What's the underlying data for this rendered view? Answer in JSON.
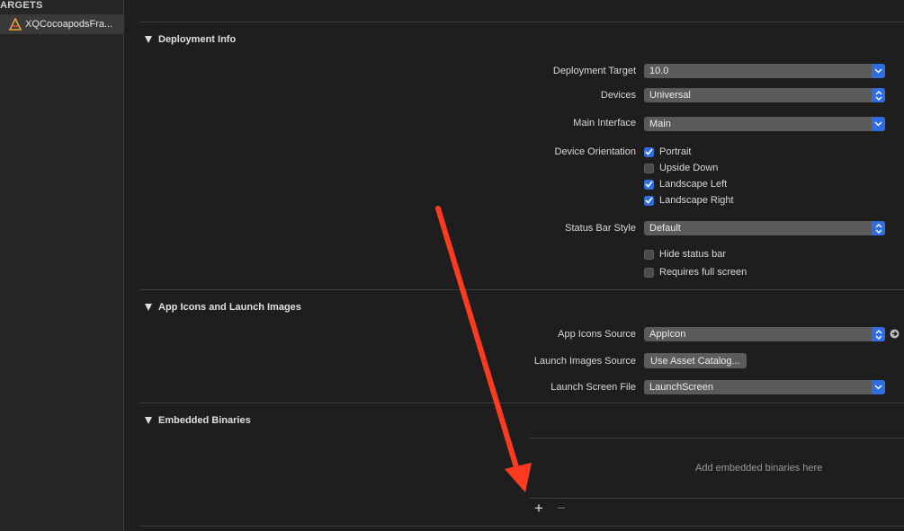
{
  "sidebar": {
    "header": "ARGETS",
    "target_label": "XQCocoapodsFra..."
  },
  "deployment": {
    "title": "Deployment Info",
    "target_label": "Deployment Target",
    "target_value": "10.0",
    "devices_label": "Devices",
    "devices_value": "Universal",
    "main_interface_label": "Main Interface",
    "main_interface_value": "Main",
    "orientation_label": "Device Orientation",
    "orientations": [
      {
        "label": "Portrait",
        "checked": true
      },
      {
        "label": "Upside Down",
        "checked": false
      },
      {
        "label": "Landscape Left",
        "checked": true
      },
      {
        "label": "Landscape Right",
        "checked": true
      }
    ],
    "status_bar_label": "Status Bar Style",
    "status_bar_value": "Default",
    "hide_status_bar": "Hide status bar",
    "requires_full_screen": "Requires full screen"
  },
  "app_icons": {
    "title": "App Icons and Launch Images",
    "icons_source_label": "App Icons Source",
    "icons_source_value": "AppIcon",
    "launch_images_label": "Launch Images Source",
    "launch_images_button": "Use Asset Catalog...",
    "launch_screen_label": "Launch Screen File",
    "launch_screen_value": "LaunchScreen"
  },
  "embedded": {
    "title": "Embedded Binaries",
    "placeholder": "Add embedded binaries here",
    "add_symbol": "+",
    "remove_symbol": "−"
  },
  "colors": {
    "background": "#1e1e1e",
    "accent": "#2f6ee0",
    "annotation_arrow": "#ff3b1f"
  }
}
